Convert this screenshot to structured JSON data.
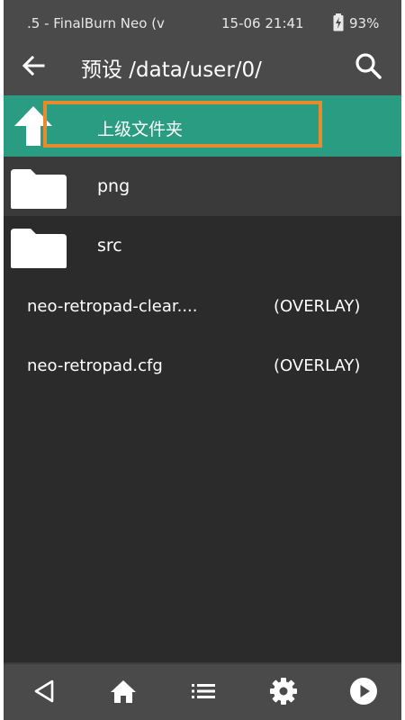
{
  "statusbar": {
    "app_title": ".5 - FinalBurn Neo (v",
    "datetime": "15-06 21:41",
    "battery": "93%",
    "battery_icon": "battery-charging-icon"
  },
  "appbar": {
    "back_icon": "arrow-left-icon",
    "title": "预设 /data/user/0/",
    "search_icon": "search-icon"
  },
  "list": {
    "parent": {
      "label": "上级文件夹",
      "icon": "arrow-up-icon"
    },
    "folders": [
      {
        "label": "png",
        "icon": "folder-icon"
      },
      {
        "label": "src",
        "icon": "folder-icon"
      }
    ],
    "files": [
      {
        "name": "neo-retropad-clear....",
        "type": "(OVERLAY)"
      },
      {
        "name": "neo-retropad.cfg",
        "type": "(OVERLAY)"
      }
    ]
  },
  "navbar": {
    "items": [
      "back-triangle-icon",
      "home-icon",
      "list-icon",
      "gear-icon",
      "play-icon"
    ]
  },
  "colors": {
    "accent": "#2a9c82",
    "highlight": "#e88a2e",
    "bar": "#4a4a4a",
    "background": "#2b2b2b"
  }
}
